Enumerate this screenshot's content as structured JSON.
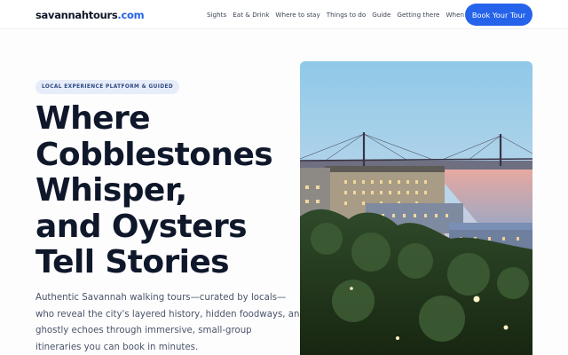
{
  "header": {
    "logo_main": "savannahtours",
    "logo_domain": ".com",
    "nav": [
      "Sights",
      "Eat & Drink",
      "Where to stay",
      "Things to do",
      "Guide",
      "Getting there",
      "When to go"
    ],
    "cta": "Book Your Tour"
  },
  "hero": {
    "badge": "LOCAL EXPERIENCE PLATFORM & GUIDED",
    "title_lines": [
      "Where",
      "Cobblestones",
      "Whisper,",
      "and Oysters",
      "Tell Stories"
    ],
    "lead_lines": [
      "Authentic Savannah walking tours—curated by locals—",
      "who reveal the city's layered history, hidden foodways, and",
      "ghostly echoes through immersive, small-group",
      "itineraries you can book in minutes."
    ]
  },
  "colors": {
    "accent": "#2563eb",
    "heading": "#0f172a",
    "badge_bg": "#e6ecf8"
  }
}
